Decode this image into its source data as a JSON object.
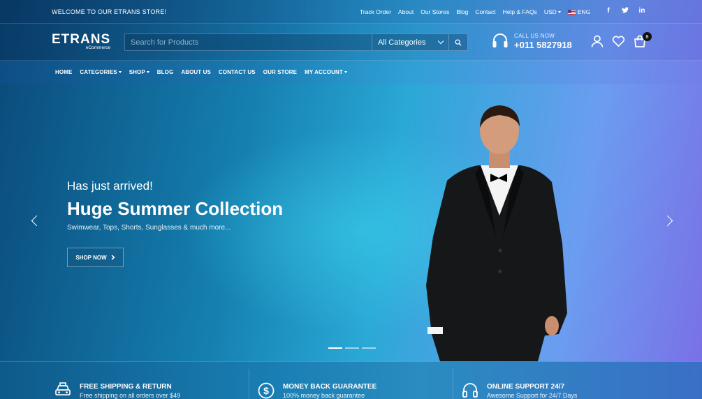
{
  "topbar": {
    "welcome": "WELCOME TO OUR ETRANS STORE!",
    "links": [
      "Track Order",
      "About",
      "Our Stores",
      "Blog",
      "Contact",
      "Help & FAQs"
    ],
    "currency": "USD",
    "language": "ENG",
    "socials": [
      "facebook-icon",
      "twitter-icon",
      "linkedin-icon"
    ]
  },
  "header": {
    "logo_main": "ETRANS",
    "logo_sub": "eCommerce",
    "search_placeholder": "Search for Products",
    "category_selected": "All Categories",
    "call_label": "CALL US NOW",
    "call_number": "+011 5827918",
    "cart_count": "8"
  },
  "nav": {
    "home": "HOME",
    "categories": "CATEGORIES",
    "shop": "SHOP",
    "blog": "BLOG",
    "about": "ABOUT US",
    "contact": "CONTACT US",
    "store": "OUR STORE",
    "account": "MY ACCOUNT"
  },
  "hero": {
    "subtitle": "Has just arrived!",
    "title": "Huge Summer Collection",
    "description": "Swimwear, Tops, Shorts, Sunglasses & much more...",
    "button": "SHOP NOW",
    "slides": 3,
    "active_slide": 1
  },
  "features": [
    {
      "icon": "taxi-icon",
      "title": "FREE SHIPPING & RETURN",
      "desc": "Free shipping on all orders over $49"
    },
    {
      "icon": "dollar-icon",
      "title": "MONEY BACK GUARANTEE",
      "desc": "100% money back guarantee"
    },
    {
      "icon": "headset-icon",
      "title": "ONLINE SUPPORT 24/7",
      "desc": "Awesome Support for 24/7 Days"
    }
  ],
  "colors": {
    "accent": "#2aa8d6",
    "brand_dark": "#0a4a7a",
    "purple": "#7a6fe6"
  }
}
